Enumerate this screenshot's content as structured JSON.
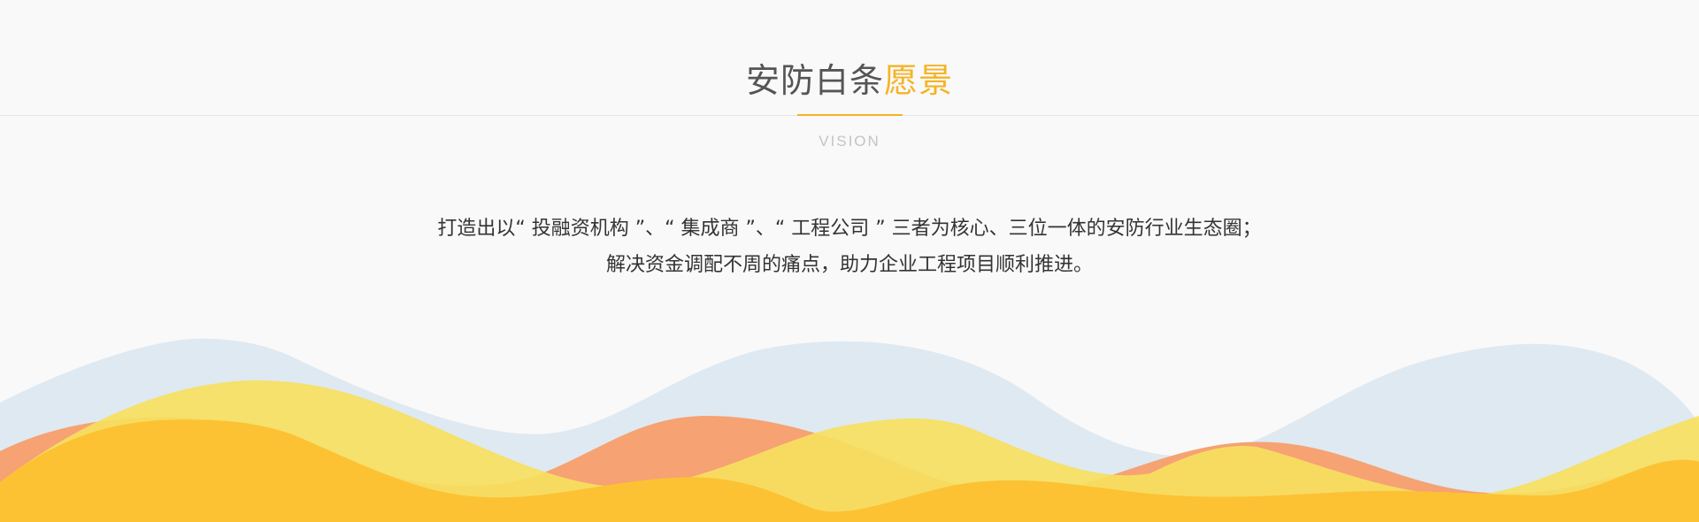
{
  "section": {
    "title_main": "安防白条",
    "title_accent": "愿景",
    "subtitle": "VISION",
    "description": [
      "打造出以“ 投融资机构 ”、“ 集成商 ”、“ 工程公司 ” 三者为核心、三位一体的安防行业生态圈；",
      "解决资金调配不周的痛点，助力企业工程项目顺利推进。"
    ]
  },
  "colors": {
    "accent": "#f5b324",
    "title_text": "#555555",
    "body_text": "#333333",
    "wave_blue": "#dfe9f1",
    "wave_orange": "#f6a273",
    "wave_yellow": "#f6df60",
    "wave_gold": "#fcc233"
  }
}
